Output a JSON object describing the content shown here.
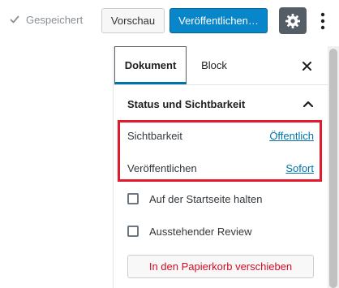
{
  "toolbar": {
    "saved_label": "Gespeichert",
    "preview_label": "Vorschau",
    "publish_label": "Veröffentlichen…"
  },
  "panel": {
    "tabs": [
      {
        "label": "Dokument",
        "active": true
      },
      {
        "label": "Block",
        "active": false
      }
    ],
    "section": {
      "title": "Status und Sichtbarkeit",
      "expanded": true,
      "rows": [
        {
          "label": "Sichtbarkeit",
          "value": "Öffentlich"
        },
        {
          "label": "Veröffentlichen",
          "value": "Sofort"
        }
      ],
      "checkboxes": [
        {
          "label": "Auf der Startseite halten",
          "checked": false
        },
        {
          "label": "Ausstehender Review",
          "checked": false
        }
      ],
      "trash_label": "In den Papierkorb verschieben"
    }
  },
  "icons": {
    "saved": "check-icon",
    "settings": "gear-icon",
    "more": "vertical-ellipsis-icon",
    "close": "close-icon",
    "section_toggle": "chevron-up-icon"
  },
  "colors": {
    "primary": "#0985c9",
    "link": "#0073aa",
    "highlight": "#e21a2b",
    "danger": "#d20d25",
    "settings_bg": "#555d66"
  }
}
